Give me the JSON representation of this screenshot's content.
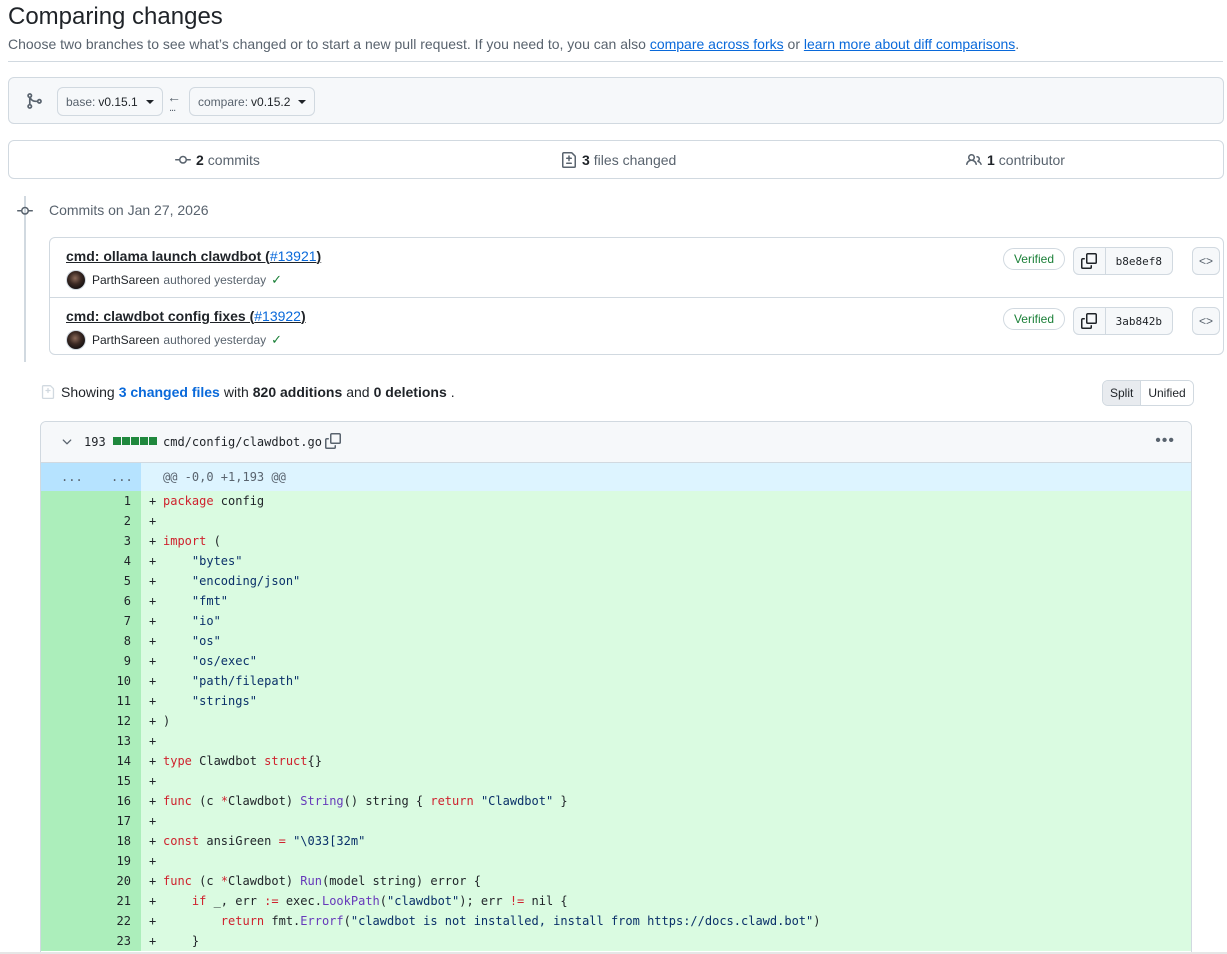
{
  "header": {
    "title": "Comparing changes",
    "subtitle_prefix": "Choose two branches to see what’s changed or to start a new pull request. If you need to, you can also ",
    "link_forks": "compare across forks",
    "subtitle_mid": " or ",
    "link_learn": "learn more about diff comparisons",
    "subtitle_suffix": "."
  },
  "range": {
    "base_label": "base:",
    "base_value": "v0.15.1",
    "compare_label": "compare:",
    "compare_value": "v0.15.2",
    "arrow": "←",
    "dots": "..."
  },
  "stats": {
    "commits_count": "2",
    "commits_label": "commits",
    "files_count": "3",
    "files_label": "files changed",
    "contributors_count": "1",
    "contributors_label": "contributor"
  },
  "commits": {
    "date_heading": "Commits on Jan 27, 2026",
    "items": [
      {
        "title": "cmd: ollama launch clawdbot (",
        "pr": "#13921",
        "title_end": ")",
        "author": "ParthSareen",
        "meta": "authored yesterday",
        "verified": "Verified",
        "sha": "b8e8ef8"
      },
      {
        "title": "cmd: clawdbot config fixes (",
        "pr": "#13922",
        "title_end": ")",
        "author": "ParthSareen",
        "meta": "authored yesterday",
        "verified": "Verified",
        "sha": "3ab842b"
      }
    ]
  },
  "summary": {
    "showing": "Showing",
    "changed_files": "3 changed files",
    "with": "with",
    "additions": "820 additions",
    "and": "and",
    "deletions": "0 deletions",
    "period": ".",
    "split_label": "Split",
    "unified_label": "Unified"
  },
  "file": {
    "count": "193",
    "path": "cmd/config/clawdbot.go",
    "hunk_left": "...",
    "hunk_right": "...",
    "hunk_header": "@@ -0,0 +1,193 @@"
  },
  "colors": {
    "accent": "#0969da",
    "added_bg": "#dafbe1",
    "added_gutter": "#aceebb",
    "hunk_bg": "#ddf4ff",
    "verified_green": "#1a7f37"
  },
  "code_lines": [
    {
      "n": "1",
      "html": "<span class=\"kw\">package</span> config"
    },
    {
      "n": "2",
      "html": ""
    },
    {
      "n": "3",
      "html": "<span class=\"kw\">import</span> ("
    },
    {
      "n": "4",
      "html": "    <span class=\"str\">\"bytes\"</span>"
    },
    {
      "n": "5",
      "html": "    <span class=\"str\">\"encoding/json\"</span>"
    },
    {
      "n": "6",
      "html": "    <span class=\"str\">\"fmt\"</span>"
    },
    {
      "n": "7",
      "html": "    <span class=\"str\">\"io\"</span>"
    },
    {
      "n": "8",
      "html": "    <span class=\"str\">\"os\"</span>"
    },
    {
      "n": "9",
      "html": "    <span class=\"str\">\"os/exec\"</span>"
    },
    {
      "n": "10",
      "html": "    <span class=\"str\">\"path/filepath\"</span>"
    },
    {
      "n": "11",
      "html": "    <span class=\"str\">\"strings\"</span>"
    },
    {
      "n": "12",
      "html": ")"
    },
    {
      "n": "13",
      "html": ""
    },
    {
      "n": "14",
      "html": "<span class=\"kw\">type</span> Clawdbot <span class=\"kw\">struct</span>{}"
    },
    {
      "n": "15",
      "html": ""
    },
    {
      "n": "16",
      "html": "<span class=\"kw\">func</span> (c <span class=\"kw\">*</span>Clawdbot) <span class=\"fn\">String</span>() string { <span class=\"kw\">return</span> <span class=\"str\">\"Clawdbot\"</span> }"
    },
    {
      "n": "17",
      "html": ""
    },
    {
      "n": "18",
      "html": "<span class=\"kw\">const</span> ansiGreen <span class=\"kw\">=</span> <span class=\"str\">\"\\033[32m\"</span>"
    },
    {
      "n": "19",
      "html": ""
    },
    {
      "n": "20",
      "html": "<span class=\"kw\">func</span> (c <span class=\"kw\">*</span>Clawdbot) <span class=\"fn\">Run</span>(model string) error {"
    },
    {
      "n": "21",
      "html": "    <span class=\"kw\">if</span> _, err <span class=\"kw\">:=</span> exec.<span class=\"fn\">LookPath</span>(<span class=\"str\">\"clawdbot\"</span>); err <span class=\"kw\">!=</span> nil {"
    },
    {
      "n": "22",
      "html": "        <span class=\"kw\">return</span> fmt.<span class=\"fn\">Errorf</span>(<span class=\"str\">\"clawdbot is not installed, install from https://docs.clawd.bot\"</span>)"
    },
    {
      "n": "23",
      "html": "    }"
    }
  ]
}
